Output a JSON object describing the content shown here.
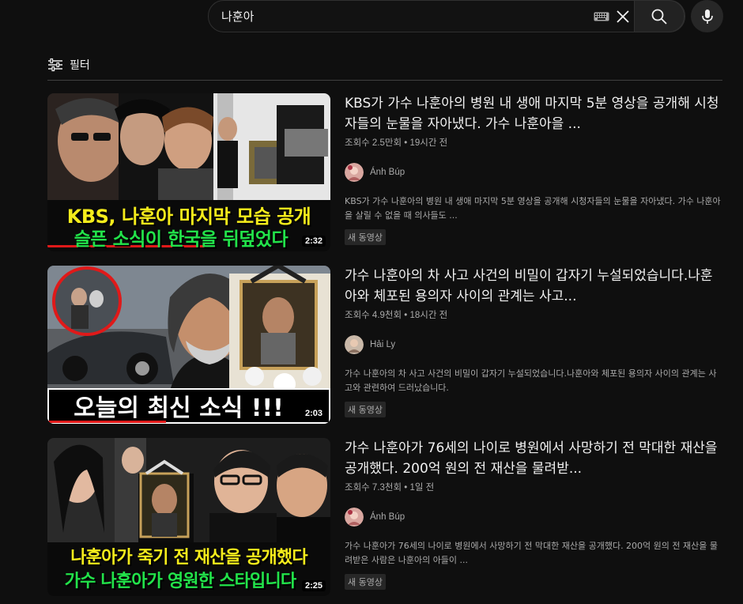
{
  "search": {
    "query": "나훈아"
  },
  "filter": {
    "label": "필터"
  },
  "results": [
    {
      "title": "KBS가 가수 나훈아의 병원 내 생애 마지막 5분 영상을 공개해 시청자들의 눈물을 자아냈다. 가수 나훈아을 ...",
      "views": "조회수 2.5만회",
      "age": "19시간 전",
      "channel": "Ánh Búp",
      "description": "KBS가 가수 나훈아의 병원 내 생애 마지막 5분 영상을 공개해 시청자들의 눈물을 자아냈다. 가수 나훈아을 살릴 수 없을 때 의사들도 ...",
      "badge": "새 동영상",
      "duration": "2:32",
      "thumb_line1": "KBS, 나훈아 마지막 모습 공개",
      "thumb_line2": "슬픈 소식이 한국을 뒤덮었다"
    },
    {
      "title": "가수 나훈아의 차 사고 사건의 비밀이 갑자기 누설되었습니다.나훈아와 체포된 용의자 사이의 관계는 사고...",
      "views": "조회수 4.9천회",
      "age": "18시간 전",
      "channel": "Hải Ly",
      "description": "가수 나훈아의 차 사고 사건의 비밀이 갑자기 누설되었습니다.나훈아와 체포된 용의자 사이의 관계는 사고와 관련하여 드러났습니다.",
      "badge": "새 동영상",
      "duration": "2:03",
      "thumb_line1": "오늘의 최신 소식 !!!"
    },
    {
      "title": "가수 나훈아가 76세의 나이로 병원에서 사망하기 전 막대한 재산을 공개했다. 200억 원의 전 재산을 물려받...",
      "views": "조회수 7.3천회",
      "age": "1일 전",
      "channel": "Ánh Búp",
      "description": "가수 나훈아가 76세의 나이로 병원에서 사망하기 전 막대한 재산을 공개했다. 200억 원의 전 재산을 물려받은 사람은 나훈아의 아들이 ...",
      "badge": "새 동영상",
      "duration": "2:25",
      "thumb_line1": "나훈아가 죽기 전 재산을 공개했다",
      "thumb_line2": "가수 나훈아가 영원한 스타입니다"
    }
  ],
  "meta_separator": " • ",
  "colors": {
    "background": "#0f0f0f",
    "caption_yellow": "#f5ec1b",
    "caption_green": "#22e34a",
    "caption_red_line": "#e01919"
  },
  "icons": [
    "filter-icon",
    "keyboard-icon",
    "clear-icon",
    "search-icon",
    "mic-icon"
  ]
}
